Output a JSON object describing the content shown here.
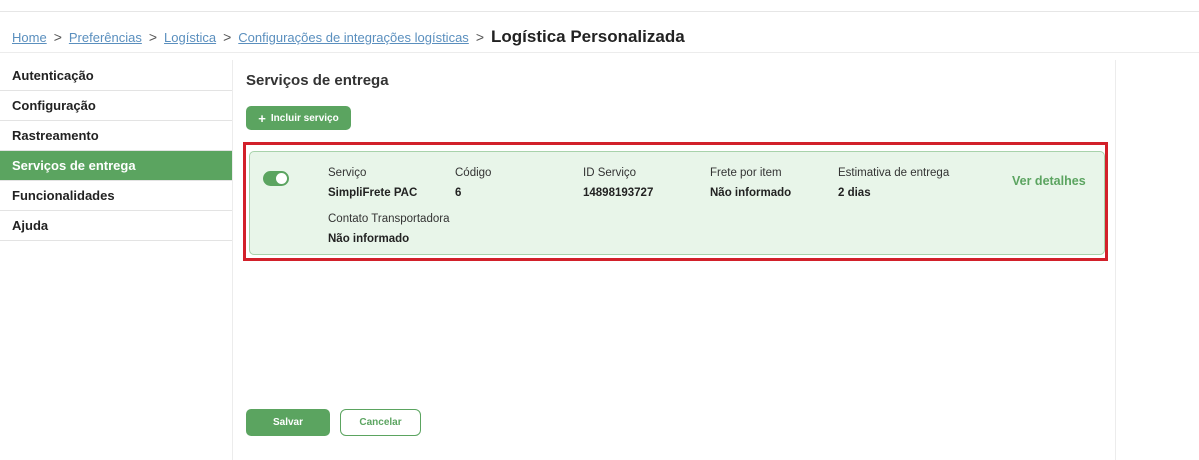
{
  "breadcrumb": {
    "items": [
      "Home",
      "Preferências",
      "Logística",
      "Configurações de integrações logísticas"
    ],
    "current": "Logística Personalizada",
    "separator": ">"
  },
  "sidebar": {
    "items": [
      {
        "label": "Autenticação"
      },
      {
        "label": "Configuração"
      },
      {
        "label": "Rastreamento"
      },
      {
        "label": "Serviços de entrega",
        "active": true
      },
      {
        "label": "Funcionalidades"
      },
      {
        "label": "Ajuda"
      }
    ]
  },
  "main": {
    "section_title": "Serviços de entrega",
    "add_button": {
      "icon": "plus-icon",
      "symbol": "+",
      "label": "Incluir serviço"
    },
    "service_card": {
      "enabled": true,
      "fields": {
        "servico": {
          "label": "Serviço",
          "value": "SimpliFrete PAC"
        },
        "codigo": {
          "label": "Código",
          "value": "6"
        },
        "id_servico": {
          "label": "ID Serviço",
          "value": "14898193727"
        },
        "frete": {
          "label": "Frete por item",
          "value": "Não informado"
        },
        "estimativa": {
          "label": "Estimativa de entrega",
          "value": "2 dias"
        },
        "contato": {
          "label": "Contato Transportadora",
          "value": "Não informado"
        }
      },
      "details_link": "Ver detalhes"
    }
  },
  "footer": {
    "save_label": "Salvar",
    "cancel_label": "Cancelar"
  },
  "colors": {
    "accent": "#5ba460",
    "highlight": "#d2202a",
    "card_bg": "#e8f5e9",
    "link": "#5a8fbe"
  }
}
